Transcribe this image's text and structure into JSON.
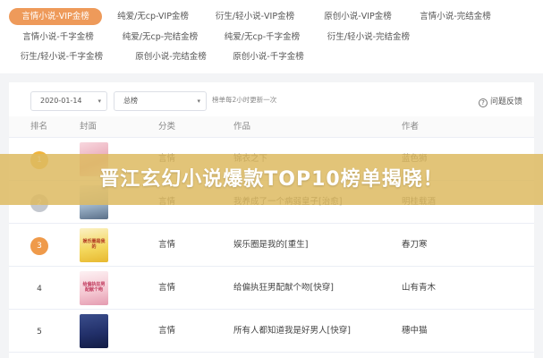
{
  "categories": [
    {
      "label": "言情小说-VIP金榜",
      "active": true
    },
    {
      "label": "纯爱/无cp-VIP金榜",
      "active": false
    },
    {
      "label": "衍生/轻小说-VIP金榜",
      "active": false
    },
    {
      "label": "原创小说-VIP金榜",
      "active": false
    },
    {
      "label": "言情小说-完结金榜",
      "active": false
    },
    {
      "label": "言情小说-千字金榜",
      "active": false
    },
    {
      "label": "纯爱/无cp-完结金榜",
      "active": false
    },
    {
      "label": "纯爱/无cp-千字金榜",
      "active": false
    },
    {
      "label": "衍生/轻小说-完结金榜",
      "active": false
    },
    {
      "label": "衍生/轻小说-千字金榜",
      "active": false
    },
    {
      "label": "原创小说-完结金榜",
      "active": false
    },
    {
      "label": "原创小说-千字金榜",
      "active": false
    }
  ],
  "filters": {
    "date": "2020-01-14",
    "board": "总榜",
    "hint": "榜单每2小时更新一次",
    "feedback": "问题反馈"
  },
  "table": {
    "headers": [
      "排名",
      "封面",
      "分类",
      "作品",
      "作者"
    ],
    "rows": [
      {
        "rank": "1",
        "category": "言情",
        "title": "锦衣之下",
        "author": "蓝色狮"
      },
      {
        "rank": "2",
        "category": "言情",
        "title": "我养成了一个病弱皇子[治愈]",
        "author": "明桂载酒"
      },
      {
        "rank": "3",
        "category": "言情",
        "title": "娱乐圈是我的[重生]",
        "author": "春刀寒"
      },
      {
        "rank": "4",
        "category": "言情",
        "title": "给偏执狂男配献个吻[快穿]",
        "author": "山有青木"
      },
      {
        "rank": "5",
        "category": "言情",
        "title": "所有人都知道我是好男人[快穿]",
        "author": "穗中猫"
      }
    ]
  },
  "cover_labels": [
    "",
    "",
    "娱乐圈是我的",
    "给偏执狂男配献个吻",
    ""
  ],
  "banner": {
    "title": "晋江玄幻小说爆款TOP10榜单揭晓！"
  },
  "colors": {
    "accent": "#ee9a5a",
    "gold": "#f0b43c",
    "silver": "#c4c8cf",
    "bronze": "#ef9a4a",
    "banner": "#ddba62"
  }
}
